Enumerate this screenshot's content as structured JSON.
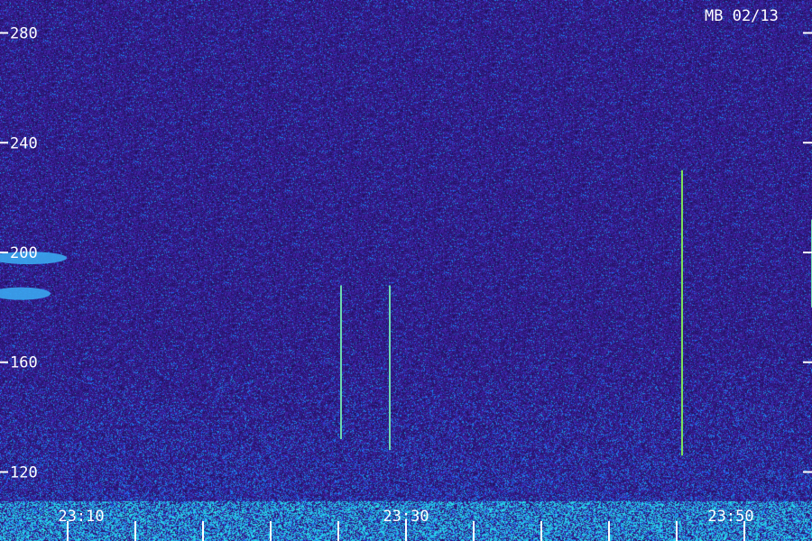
{
  "chart_data": {
    "type": "heatmap",
    "title": "MB 02/13",
    "y_ticks": [
      "280",
      "240",
      "200",
      "160",
      "120"
    ],
    "y_tick_values": [
      280,
      240,
      200,
      160,
      120
    ],
    "ylim": [
      108,
      292
    ],
    "x_tick_labels": [
      "23:10",
      "23:30",
      "23:50"
    ],
    "x_range_minutes": [
      "23:05",
      "23:55"
    ],
    "x_minor_tick_count": 12,
    "grid": false,
    "colormap": [
      "#1a0f5a",
      "#2b1b9e",
      "#2f4fd8",
      "#2fb4e8",
      "#39e07a",
      "#e0d23a"
    ],
    "vertical_signals": [
      {
        "time": "23:26",
        "y_from": 132,
        "y_to": 188
      },
      {
        "time": "23:29",
        "y_from": 128,
        "y_to": 188
      },
      {
        "time": "23:47",
        "y_from": 126,
        "y_to": 230
      },
      {
        "time": "23:55",
        "y_from": 180,
        "y_to": 212
      }
    ],
    "horizontal_signals": [
      {
        "y": 198,
        "time_from": "23:05",
        "time_to": "23:09"
      },
      {
        "y": 185,
        "time_from": "23:05",
        "time_to": "23:08"
      }
    ]
  }
}
